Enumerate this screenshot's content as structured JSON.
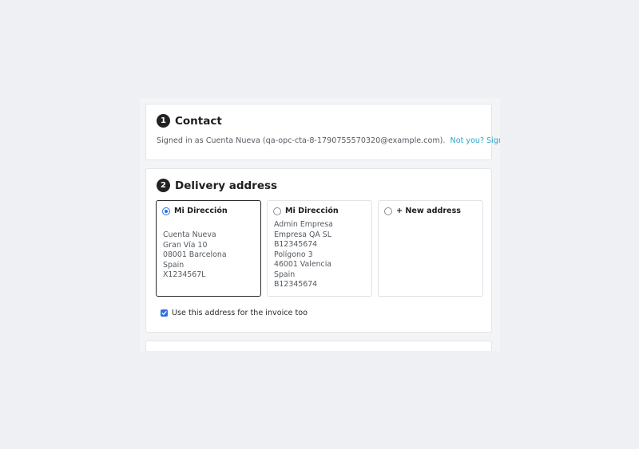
{
  "contact": {
    "step_number": "1",
    "title": "Contact",
    "signed_in_text": "Signed in as Cuenta Nueva (qa-opc-cta-8-1790755570320@example.com).",
    "sign_out_link": "Not you? Sign out"
  },
  "delivery": {
    "step_number": "2",
    "title": "Delivery address",
    "addresses": [
      {
        "title": "Mi Dirección",
        "selected": true,
        "lines": [
          "Cuenta Nueva",
          "Gran Vía 10",
          "08001 Barcelona",
          "Spain",
          "X1234567L"
        ]
      },
      {
        "title": "Mi Dirección",
        "selected": false,
        "lines": [
          "Admin Empresa",
          "Empresa QA SL",
          "B12345674",
          "Polígono 3",
          "46001 Valencia",
          "Spain",
          "B12345674"
        ]
      },
      {
        "title": "+ New address",
        "selected": false,
        "lines": []
      }
    ],
    "use_for_invoice": {
      "label": "Use this address for the invoice too",
      "checked": true
    }
  },
  "colors": {
    "accent_link": "#2aa6cf",
    "checkbox_radio": "#2f6fdf",
    "page_background": "#eef0f3"
  }
}
